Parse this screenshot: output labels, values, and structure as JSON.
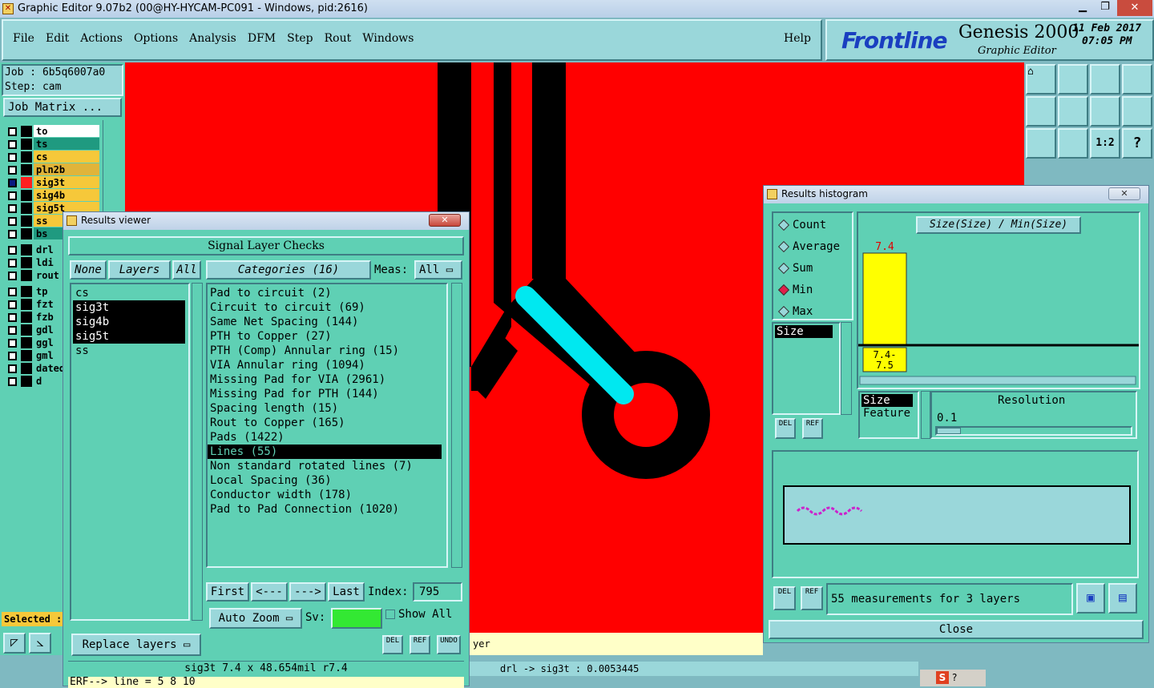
{
  "app": {
    "title": "Graphic Editor 9.07b2 (00@HY-HYCAM-PC091 - Windows, pid:2616)"
  },
  "menu": {
    "items": [
      "File",
      "Edit",
      "Actions",
      "Options",
      "Analysis",
      "DFM",
      "Step",
      "Rout",
      "Windows"
    ],
    "help": "Help"
  },
  "brand": {
    "logo": "Frontline",
    "product": "Genesis 2000",
    "subtitle": "Graphic Editor",
    "date": "11 Feb 2017",
    "time": "07:05 PM"
  },
  "job": {
    "job": "Job : 6b5q6007a0",
    "step": "Step: cam",
    "matrix_btn": "Job Matrix ..."
  },
  "layers": [
    {
      "name": "to",
      "color": "#ffffff",
      "state": "white"
    },
    {
      "name": "ts",
      "color": "#1f9a80"
    },
    {
      "name": "cs",
      "color": "#f6c83a"
    },
    {
      "name": "pln2b",
      "color": "#e0b43a"
    },
    {
      "name": "sig3t",
      "color": "#f6c83a",
      "active": true
    },
    {
      "name": "sig4b",
      "color": "#f6c83a"
    },
    {
      "name": "sig5t",
      "color": "#f6c83a"
    },
    {
      "name": "ss",
      "color": "#f6c83a"
    },
    {
      "name": "bs",
      "color": "#1f9a80"
    },
    {
      "name": "drl",
      "color": "#5fd0b4"
    },
    {
      "name": "ldi",
      "color": "#5fd0b4"
    },
    {
      "name": "rout",
      "color": "#5fd0b4"
    },
    {
      "name": "tp",
      "color": "#5fd0b4"
    },
    {
      "name": "fzt",
      "color": "#5fd0b4"
    },
    {
      "name": "fzb",
      "color": "#5fd0b4"
    },
    {
      "name": "gdl",
      "color": "#5fd0b4"
    },
    {
      "name": "ggl",
      "color": "#5fd0b4"
    },
    {
      "name": "gml",
      "color": "#5fd0b4"
    },
    {
      "name": "dated",
      "color": "#5fd0b4"
    },
    {
      "name": "d",
      "color": "#5fd0b4"
    }
  ],
  "selected_label": "Selected :",
  "results_viewer": {
    "title": "Results viewer",
    "header": "Signal Layer Checks",
    "none_btn": "None",
    "layers_btn": "Layers",
    "all_btn": "All",
    "categories_btn": "Categories (16)",
    "meas_label": "Meas:",
    "meas_value": "All",
    "layer_list": [
      {
        "name": "cs",
        "sel": false
      },
      {
        "name": "sig3t",
        "sel": true
      },
      {
        "name": "sig4b",
        "sel": true
      },
      {
        "name": "sig5t",
        "sel": true
      },
      {
        "name": "ss",
        "sel": false
      }
    ],
    "categories": [
      {
        "t": "Pad to circuit (2)"
      },
      {
        "t": "Circuit to circuit (69)"
      },
      {
        "t": "Same Net Spacing (144)"
      },
      {
        "t": "PTH to Copper (27)"
      },
      {
        "t": "PTH (Comp) Annular ring (15)"
      },
      {
        "t": "VIA Annular ring (1094)"
      },
      {
        "t": "Missing Pad for VIA (2961)"
      },
      {
        "t": "Missing Pad for PTH (144)"
      },
      {
        "t": "Spacing length (15)"
      },
      {
        "t": "Rout to Copper (165)"
      },
      {
        "t": "Pads (1422)"
      },
      {
        "t": "Lines (55)",
        "sel": true
      },
      {
        "t": "Non standard rotated lines (7)"
      },
      {
        "t": "Local Spacing (36)"
      },
      {
        "t": "Conductor width (178)"
      },
      {
        "t": "Pad to Pad Connection (1020)"
      }
    ],
    "first": "First",
    "prev": "<---",
    "next": "--->",
    "last": "Last",
    "index_label": "Index:",
    "index_value": "795",
    "auto_zoom": "Auto Zoom",
    "sv_label": "Sv:",
    "show_all": "Show All",
    "replace_layers": "Replace layers",
    "del": "DEL",
    "ref": "REF",
    "undo": "UNDO"
  },
  "status": {
    "feature": "sig3t 7.4 x 48.654mil  r7.4",
    "erf": "ERF--> line = 5 8 10",
    "drill": "drl -> sig3t : 0.0053445",
    "layer_tail": "yer"
  },
  "histogram": {
    "title": "Results histogram",
    "modes": [
      {
        "label": "Count"
      },
      {
        "label": "Average"
      },
      {
        "label": "Sum"
      },
      {
        "label": "Min",
        "on": true
      },
      {
        "label": "Max"
      }
    ],
    "size_item": "Size",
    "chart_title": "Size(Size) / Min(Size)",
    "sort_items": [
      "Size",
      "Feature"
    ],
    "resolution_label": "Resolution",
    "resolution_value": "0.1",
    "summary": "55 measurements for 3 layers",
    "close": "Close",
    "del": "DEL",
    "ref": "REF"
  },
  "chart_data": {
    "type": "bar",
    "categories": [
      "7.4-\n7.5"
    ],
    "values": [
      7.4
    ],
    "title": "Size(Size) / Min(Size)",
    "bar_color": "#ffff00",
    "value_label_color": "#e00000"
  },
  "colors": {
    "canvas": "#ff0000",
    "trace": "#000000",
    "highlight": "#00e8f0",
    "panel": "#5fd0b4"
  }
}
